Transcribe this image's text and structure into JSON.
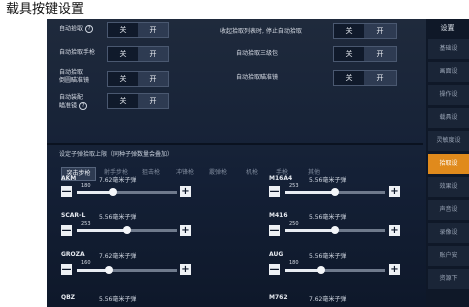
{
  "caption": "载具按键设置",
  "toggles_left": [
    {
      "label": "自动拾取",
      "help": true,
      "off": "关",
      "on": "开",
      "state": "on"
    },
    {
      "label": "自动拾取手枪",
      "help": false,
      "off": "关",
      "on": "开",
      "state": "off"
    },
    {
      "label": "自动拾取\n倒圆瞄准镜",
      "help": false,
      "off": "关",
      "on": "开",
      "state": "off"
    },
    {
      "label": "自动装配\n瞄准镜",
      "help": true,
      "off": "关",
      "on": "开",
      "state": "off"
    }
  ],
  "toggles_right": [
    {
      "label": "收起拾取列表时, 停止自动拾取",
      "off": "关",
      "on": "开",
      "state": "off"
    },
    {
      "label": "自动拾取三级包",
      "off": "关",
      "on": "开",
      "state": "off"
    },
    {
      "label": "自动拾取瞄准镜",
      "off": "关",
      "on": "开",
      "state": "off"
    }
  ],
  "ammo_section_title": "设定子弹拾取上限（同种子弹数量会叠加）",
  "weapon_tabs": [
    "突击步枪",
    "射手步枪",
    "狙击枪",
    "冲锋枪",
    "霰弹枪",
    "机枪",
    "手枪",
    "其他"
  ],
  "active_tab": 0,
  "weapons": [
    {
      "name": "AKM",
      "ammo": "7.62毫米子弹",
      "value": "180",
      "level": 0.36
    },
    {
      "name": "M16A4",
      "ammo": "5.56毫米子弹",
      "value": "253",
      "level": 0.5
    },
    {
      "name": "SCAR-L",
      "ammo": "5.56毫米子弹",
      "value": "253",
      "level": 0.5
    },
    {
      "name": "M416",
      "ammo": "5.56毫米子弹",
      "value": "250",
      "level": 0.5
    },
    {
      "name": "GROZA",
      "ammo": "7.62毫米子弹",
      "value": "160",
      "level": 0.32
    },
    {
      "name": "AUG",
      "ammo": "5.56毫米子弹",
      "value": "180",
      "level": 0.36
    },
    {
      "name": "QBZ",
      "ammo": "5.56毫米子弹",
      "value": "",
      "level": 0
    },
    {
      "name": "M762",
      "ammo": "7.62毫米子弹",
      "value": "",
      "level": 0
    }
  ],
  "minus": "—",
  "plus": "+",
  "sidebar": {
    "header": "设置",
    "items": [
      "基础设",
      "画面设",
      "操作设",
      "载具设",
      "灵敏度设",
      "拾取设",
      "效果设",
      "声音设",
      "录像设",
      "账户安",
      "资源下"
    ],
    "active": 5
  }
}
